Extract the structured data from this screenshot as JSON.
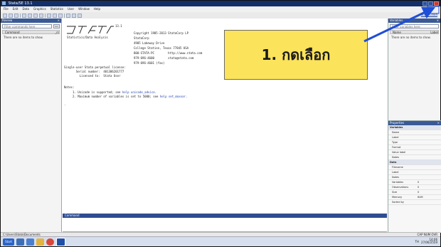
{
  "window": {
    "title": "Stata/SE 13.1"
  },
  "menubar": {
    "items": [
      "File",
      "Edit",
      "Data",
      "Graphics",
      "Statistics",
      "User",
      "Window",
      "Help"
    ]
  },
  "toolbar": {
    "right_link": "Stata Cloud"
  },
  "left_panel": {
    "title": "Review",
    "search_placeholder": "Filter commands here",
    "search_button": "Go",
    "col_header": "Command",
    "col_rc": "_rc",
    "empty_message": "There are no items to show."
  },
  "right_panel": {
    "title": "Variables",
    "search_placeholder": "Filter variables here",
    "col_name": "Name",
    "col_label": "Label",
    "empty_message": "There are no items to show."
  },
  "properties": {
    "title": "Properties",
    "rows": [
      {
        "section": true,
        "k": "Variables",
        "v": ""
      },
      {
        "k": "Name",
        "v": ""
      },
      {
        "k": "Label",
        "v": ""
      },
      {
        "k": "Type",
        "v": ""
      },
      {
        "k": "Format",
        "v": ""
      },
      {
        "k": "Value label",
        "v": ""
      },
      {
        "k": "Notes",
        "v": ""
      },
      {
        "section": true,
        "k": "Data",
        "v": ""
      },
      {
        "k": "Filename",
        "v": ""
      },
      {
        "k": "Label",
        "v": ""
      },
      {
        "k": "Notes",
        "v": ""
      },
      {
        "k": "Variables",
        "v": "0"
      },
      {
        "k": "Observations",
        "v": "0"
      },
      {
        "k": "Size",
        "v": "0"
      },
      {
        "k": "Memory",
        "v": "64M"
      },
      {
        "k": "Sorted by",
        "v": ""
      }
    ]
  },
  "editor": {
    "version": "13.1",
    "tagline": "Statistics/Data Analysis",
    "company": [
      "Copyright 1985-2013 StataCorp LP",
      "StataCorp",
      "4905 Lakeway Drive",
      "College Station, Texas 77845 USA",
      "800-STATA-PC        http://www.stata.com",
      "979-696-4600        stata@stata.com",
      "979-696-4601 (fax)"
    ],
    "license_lines": [
      "Single-user Stata perpetual license:",
      "       Serial number:  401306201777",
      "         Licensed to:  Stata User"
    ],
    "notes_heading": "Notes:",
    "notes": [
      {
        "num": "1.",
        "text": "Unicode is supported; see ",
        "link": "help unicode_advice."
      },
      {
        "num": "2.",
        "text": "Maximum number of variables is set to 5000; see ",
        "link": "help set_maxvar."
      }
    ],
    "prompt": "."
  },
  "output_bar": {
    "label": "Command"
  },
  "status": {
    "path": "C:\\Users\\Stata\\Documents",
    "right": "CAP NUM OVR"
  },
  "taskbar": {
    "start": "Start",
    "tray_lang": "TH",
    "tray_time": "14:06",
    "tray_date": "27/06/2559"
  },
  "callout": {
    "text": "1. กดเลือก",
    "fill": "#fbe35b"
  },
  "arrow": {
    "color": "#1f4fd8"
  }
}
